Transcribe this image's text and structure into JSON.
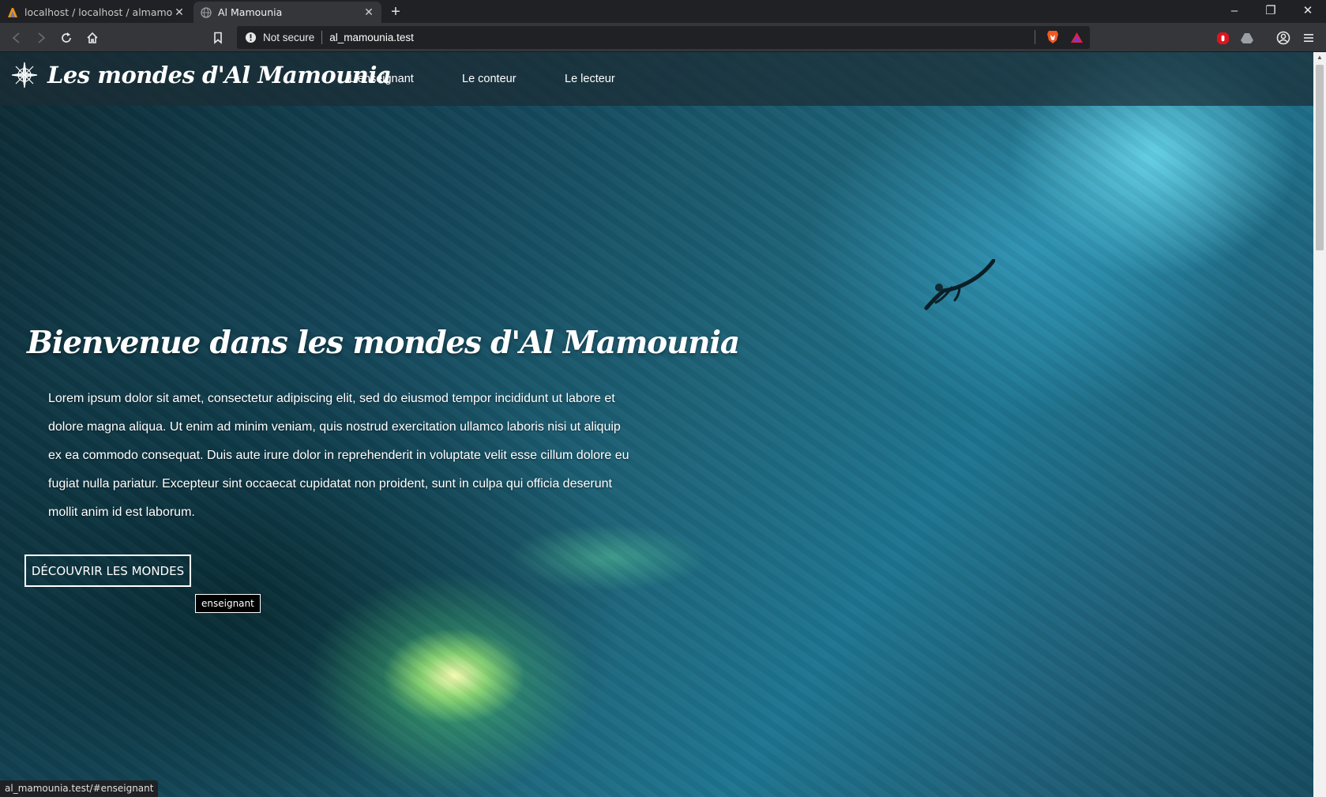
{
  "browser": {
    "tabs": [
      {
        "label": "localhost / localhost / almamounia",
        "active": false
      },
      {
        "label": "Al Mamounia",
        "active": true
      }
    ],
    "new_tab": "+",
    "window_controls": {
      "minimize": "–",
      "restore": "❐",
      "close": "✕"
    },
    "omnibox": {
      "security": "Not secure",
      "url": "al_mamounia.test"
    },
    "status_url": "al_mamounia.test/#enseignant"
  },
  "site": {
    "brand": "Les mondes d'Al Mamounia",
    "nav": [
      "L'enseignant",
      "Le conteur",
      "Le lecteur"
    ],
    "hero": {
      "title": "Bienvenue dans les mondes d'Al Mamounia",
      "text": "Lorem ipsum dolor sit amet, consectetur adipiscing elit, sed do eiusmod tempor incididunt ut labore et dolore magna aliqua. Ut enim ad minim veniam, quis nostrud exercitation ullamco laboris nisi ut aliquip ex ea commodo consequat. Duis aute irure dolor in reprehenderit in voluptate velit esse cillum dolore eu fugiat nulla pariatur. Excepteur sint occaecat cupidatat non proident, sunt in culpa qui officia deserunt mollit anim id est laborum.",
      "cta": "DÉCOUVRIR LES MONDES",
      "tooltip": "enseignant"
    }
  },
  "colors": {
    "nav_bg": "#1c2c34",
    "browser_dark": "#202124",
    "toolbar": "#35363a"
  }
}
